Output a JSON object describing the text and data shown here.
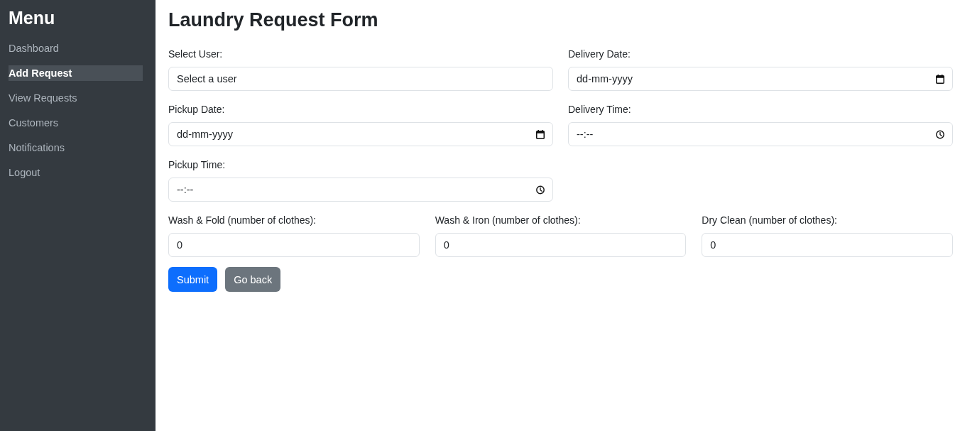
{
  "sidebar": {
    "title": "Menu",
    "items": [
      {
        "label": "Dashboard",
        "selected": false
      },
      {
        "label": "Add Request",
        "selected": true
      },
      {
        "label": "View Requests",
        "selected": false
      },
      {
        "label": "Customers",
        "selected": false
      },
      {
        "label": "Notifications",
        "selected": false
      },
      {
        "label": "Logout",
        "selected": false
      }
    ]
  },
  "page_title": "Laundry Request Form",
  "form": {
    "columns": [
      [
        {
          "label": "Select User:",
          "kind": "select",
          "value": "Select a user"
        },
        {
          "label": "Pickup Date:",
          "kind": "date",
          "placeholder": "dd-mm-yyyy"
        },
        {
          "label": "Pickup Time:",
          "kind": "time",
          "placeholder": "--:--"
        }
      ],
      [
        {
          "label": "Delivery Date:",
          "kind": "date",
          "placeholder": "dd-mm-yyyy"
        },
        {
          "label": "Delivery Time:",
          "kind": "time",
          "placeholder": "--:--"
        }
      ]
    ],
    "quantities": [
      {
        "label": "Wash & Fold (number of clothes):",
        "value": "0"
      },
      {
        "label": "Wash & Iron (number of clothes):",
        "value": "0"
      },
      {
        "label": "Dry Clean (number of clothes):",
        "value": "0"
      }
    ],
    "buttons": [
      {
        "label": "Submit",
        "kind": "primary"
      },
      {
        "label": "Go back",
        "kind": "secondary"
      }
    ]
  }
}
